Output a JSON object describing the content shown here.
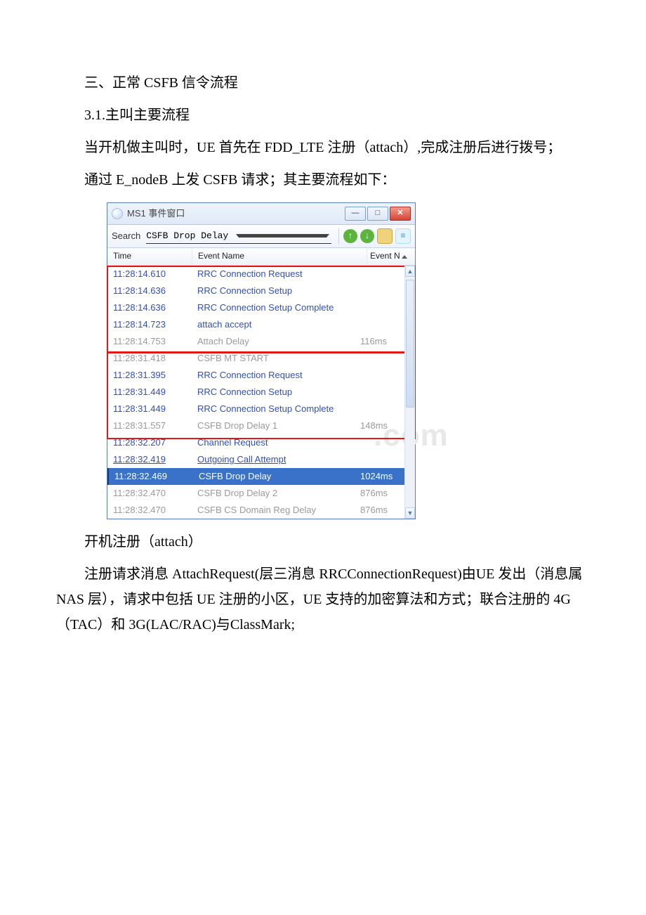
{
  "text": {
    "h1": "三、正常 CSFB 信令流程",
    "h2": "3.1.主叫主要流程",
    "p1": "当开机做主叫时，UE 首先在 FDD_LTE 注册（attach）,完成注册后进行拨号；",
    "p2": "通过 E_nodeB 上发 CSFB 请求；其主要流程如下：",
    "p3": "开机注册（attach）",
    "p4": "注册请求消息 AttachRequest(层三消息 RRCConnectionRequest)由UE 发出（消息属 NAS 层），请求中包括 UE 注册的小区，UE 支持的加密算法和方式；联合注册的 4G（TAC）和 3G(LAC/RAC)与ClassMark;"
  },
  "window": {
    "title": "MS1 事件窗口",
    "search_label": "Search",
    "search_value": "CSFB Drop Delay",
    "columns": {
      "time": "Time",
      "event": "Event Name",
      "value": "Event N"
    },
    "rows": [
      {
        "time": "11:28:14.610",
        "event": "RRC Connection Request",
        "val": "",
        "style": "blue"
      },
      {
        "time": "11:28:14.636",
        "event": "RRC Connection Setup",
        "val": "",
        "style": "blue"
      },
      {
        "time": "11:28:14.636",
        "event": "RRC Connection Setup Complete",
        "val": "",
        "style": "blue"
      },
      {
        "time": "11:28:14.723",
        "event": "attach accept",
        "val": "",
        "style": "blue"
      },
      {
        "time": "11:28:14.753",
        "event": "Attach Delay",
        "val": "116ms",
        "style": "grey"
      },
      {
        "time": "11:28:31.418",
        "event": "CSFB MT START",
        "val": "",
        "style": "grey"
      },
      {
        "time": "11:28:31.395",
        "event": "RRC Connection Request",
        "val": "",
        "style": "blue"
      },
      {
        "time": "11:28:31.449",
        "event": "RRC Connection Setup",
        "val": "",
        "style": "blue"
      },
      {
        "time": "11:28:31.449",
        "event": "RRC Connection Setup Complete",
        "val": "",
        "style": "blue"
      },
      {
        "time": "11:28:31.557",
        "event": "CSFB Drop Delay 1",
        "val": "148ms",
        "style": "grey"
      },
      {
        "time": "11:28:32.207",
        "event": "Channel Request",
        "val": "",
        "style": "blue"
      },
      {
        "time": "11:28:32.419",
        "event": "Outgoing Call Attempt",
        "val": "",
        "style": "blue-underline"
      },
      {
        "time": "11:28:32.469",
        "event": "CSFB Drop Delay",
        "val": "1024ms",
        "style": "sel"
      },
      {
        "time": "11:28:32.470",
        "event": "CSFB Drop Delay 2",
        "val": "876ms",
        "style": "grey"
      },
      {
        "time": "11:28:32.470",
        "event": "CSFB CS Domain Reg Delay",
        "val": "876ms",
        "style": "grey"
      }
    ]
  },
  "watermark": ".com"
}
